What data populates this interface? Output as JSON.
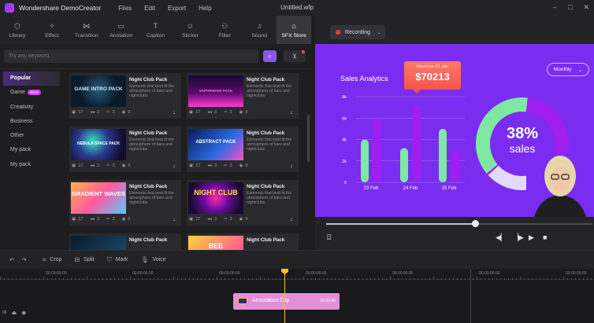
{
  "app": {
    "name": "Wondershare DemoCreator",
    "document_title": "Untitled.wfp",
    "menu": [
      "Files",
      "Edit",
      "Export",
      "Help"
    ]
  },
  "toolbar": {
    "tabs": [
      {
        "label": "Library",
        "icon": "library-icon",
        "glyph": "⬡"
      },
      {
        "label": "Effect",
        "icon": "effect-icon",
        "glyph": "✧"
      },
      {
        "label": "Transition",
        "icon": "transition-icon",
        "glyph": "⋈"
      },
      {
        "label": "Anotation",
        "icon": "annotation-icon",
        "glyph": "▭"
      },
      {
        "label": "Caption",
        "icon": "caption-icon",
        "glyph": "T"
      },
      {
        "label": "Sticker",
        "icon": "sticker-icon",
        "glyph": "☺"
      },
      {
        "label": "Filter",
        "icon": "filter-icon",
        "glyph": "⚇"
      },
      {
        "label": "Sound",
        "icon": "sound-icon",
        "glyph": "♫"
      },
      {
        "label": "SFX Store",
        "icon": "store-icon",
        "glyph": "⌂",
        "active": true
      }
    ]
  },
  "search": {
    "placeholder": "Try any keyword..."
  },
  "categories": [
    {
      "label": "Popular",
      "active": true
    },
    {
      "label": "Game",
      "badge": "NEW"
    },
    {
      "label": "Creativity"
    },
    {
      "label": "Business"
    },
    {
      "label": "Other"
    },
    {
      "label": "My pack"
    },
    {
      "label": "My pack"
    }
  ],
  "cards": [
    {
      "title": "Night Club Pack",
      "desc": "Elements that best fit the atmosphere of bars and nightclubs",
      "thumb": "GAME INTRO PACK",
      "stats": [
        "17",
        "3",
        "3",
        "9"
      ]
    },
    {
      "title": "Night Club Pack",
      "desc": "Elements that best fit the atmosphere of bars and nightclubs",
      "thumb": "VAPORWAVE PACK",
      "stats": [
        "17",
        "3",
        "3",
        "9"
      ]
    },
    {
      "title": "Night Club Pack",
      "desc": "Elements that best fit the atmosphere of bars and nightclubs",
      "thumb": "NEBULA SPACE PACK",
      "stats": [
        "17",
        "3",
        "3",
        "9"
      ]
    },
    {
      "title": "Night Club Pack",
      "desc": "Elements that best fit the atmosphere of bars and nightclubs",
      "thumb": "ABSTRACT PACK",
      "stats": [
        "17",
        "3",
        "3",
        "9"
      ]
    },
    {
      "title": "Night Club Pack",
      "desc": "Elements that best fit the atmosphere of bars and nightclubs",
      "thumb": "GRADIENT WAVES",
      "stats": [
        "17",
        "3",
        "3",
        "9"
      ]
    },
    {
      "title": "Night Club Pack",
      "desc": "Elements that best fit the atmosphere of bars and nightclubs",
      "thumb": "NIGHT CLUB",
      "stats": [
        "17",
        "3",
        "3",
        "9"
      ]
    },
    {
      "title": "Night Club Pack",
      "desc": "Elements that best fit the atmosphere of bars and nightclubs",
      "thumb": "",
      "stats": []
    },
    {
      "title": "Night Club Pack",
      "desc": "Elements that best fit the atmosphere of bars and nightclubs",
      "thumb": "BEE",
      "stats": []
    }
  ],
  "recording": {
    "label": "Recording"
  },
  "preview": {
    "title": "Sales Analytics",
    "tooltip_label": "Revenue 21 Jan",
    "tooltip_value": "$70213",
    "period": "Monthly",
    "donut_pct": "38%",
    "donut_label": "sales",
    "colors": {
      "bg": "#7a2df0",
      "green": "#7ee8a2",
      "purple": "#a21df0",
      "accent": "#ff6b5e"
    }
  },
  "chart_data": {
    "type": "bar",
    "title": "Sales Analytics",
    "categories": [
      "23 Feb",
      "24 Feb",
      "25 Feb"
    ],
    "yticks": [
      "8k",
      "6k",
      "4k",
      "2k",
      "0"
    ],
    "ylim": [
      0,
      8000
    ],
    "series": [
      {
        "values": [
          4000,
          6000,
          3200,
          7200,
          5000,
          3000
        ]
      }
    ],
    "grid": true
  },
  "editbar": {
    "items": [
      {
        "label": "Crop",
        "icon": "crop-icon",
        "glyph": "⌗"
      },
      {
        "label": "Split",
        "icon": "split-icon",
        "glyph": "⊟"
      },
      {
        "label": "Mark",
        "icon": "mark-icon",
        "glyph": "⛉"
      },
      {
        "label": "Voice",
        "icon": "voice-icon",
        "glyph": "🎙"
      }
    ]
  },
  "timeline": {
    "timecodes": [
      "00:00:00:00",
      "00:00:00:00",
      "00:00:00:00",
      "00:00:00:00",
      "00:00:00:00",
      "00:00:00:00",
      "00:00:00:00"
    ],
    "clip_label": "Annotation Clip",
    "clip_duration": "00:00:40"
  }
}
